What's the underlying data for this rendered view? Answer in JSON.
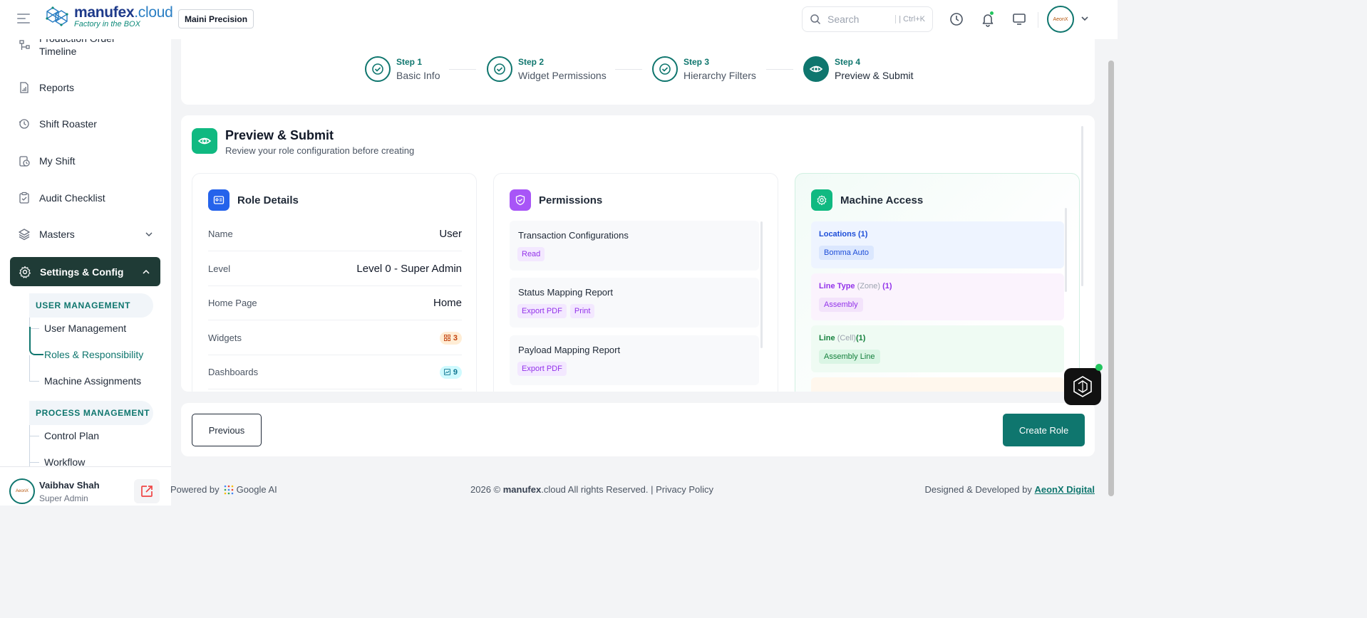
{
  "header": {
    "brand_name_bold": "manufex",
    "brand_name_suffix": ".cloud",
    "brand_tagline": "Factory in the BOX",
    "company": "Maini Precision",
    "search_placeholder": "Search",
    "search_shortcut": "| Ctrl+K",
    "icons": [
      "menu-icon",
      "history-icon",
      "bell-icon",
      "monitor-icon",
      "chevron-down-icon"
    ]
  },
  "sidebar": {
    "top_item": "Production Order Timeline",
    "items": [
      {
        "label": "Reports",
        "icon": "report-icon"
      },
      {
        "label": "Shift Roaster",
        "icon": "shift-icon"
      },
      {
        "label": "My Shift",
        "icon": "clock-icon"
      },
      {
        "label": "Audit Checklist",
        "icon": "checklist-icon"
      },
      {
        "label": "Masters",
        "icon": "layers-icon"
      }
    ],
    "active": "Settings & Config",
    "sections": [
      {
        "label": "USER MANAGEMENT",
        "items": [
          "User Management",
          "Roles & Responsibility",
          "Machine Assignments"
        ]
      },
      {
        "label": "PROCESS MANAGEMENT",
        "items": [
          "Control Plan",
          "Workflow"
        ]
      }
    ],
    "active_sub": "Roles & Responsibility",
    "user": {
      "name": "Vaibhav Shah",
      "role": "Super Admin"
    }
  },
  "stepper": {
    "steps": [
      {
        "num": "Step 1",
        "name": "Basic Info",
        "state": "done"
      },
      {
        "num": "Step 2",
        "name": "Widget Permissions",
        "state": "done"
      },
      {
        "num": "Step 3",
        "name": "Hierarchy Filters",
        "state": "done"
      },
      {
        "num": "Step 4",
        "name": "Preview & Submit",
        "state": "current"
      }
    ]
  },
  "preview": {
    "title": "Preview & Submit",
    "subtitle": "Review your role configuration before creating"
  },
  "role_details": {
    "title": "Role Details",
    "rows": [
      {
        "label": "Name",
        "value": "User"
      },
      {
        "label": "Level",
        "value": "Level 0 - Super Admin"
      },
      {
        "label": "Home Page",
        "value": "Home"
      },
      {
        "label": "Widgets",
        "value": "3"
      },
      {
        "label": "Dashboards",
        "value": "9"
      }
    ]
  },
  "permissions": {
    "title": "Permissions",
    "items": [
      {
        "name": "Transaction Configurations",
        "tags": [
          "Read"
        ]
      },
      {
        "name": "Status Mapping Report",
        "tags": [
          "Export PDF",
          "Print"
        ]
      },
      {
        "name": "Payload Mapping Report",
        "tags": [
          "Export PDF"
        ]
      }
    ]
  },
  "machine_access": {
    "title": "Machine Access",
    "groups": [
      {
        "label": "Locations",
        "qualifier": "",
        "count": "(1)",
        "tag": "Bomma Auto",
        "color": "#1d4ed8",
        "bg": "#eef4ff",
        "tag_bg": "#dbe7fe"
      },
      {
        "label": "Line Type",
        "qualifier": "(Zone)",
        "count": "(1)",
        "tag": "Assembly",
        "color": "#9333ea",
        "bg": "#fbf3fd",
        "tag_bg": "#f3e3fb"
      },
      {
        "label": "Line",
        "qualifier": "(Cell)",
        "count": "(1)",
        "tag": "Assembly Line",
        "color": "#15803d",
        "bg": "#effbf3",
        "tag_bg": "#daf5e4"
      }
    ]
  },
  "actions": {
    "previous": "Previous",
    "create": "Create Role"
  },
  "footer": {
    "powered_by": "Powered by",
    "google_ai": "Google AI",
    "copyright_prefix": "2026 ©",
    "brand_bold": "manufex",
    "copyright_suffix": ".cloud All rights Reserved. | Privacy Policy",
    "designed_by": "Designed & Developed by",
    "company_link": "AeonX Digital"
  },
  "colors": {
    "primary": "#0f766e",
    "sidebar_active": "#1f3b36",
    "accent_green": "#10b981",
    "purple": "#9333ea",
    "blue": "#2563eb"
  }
}
